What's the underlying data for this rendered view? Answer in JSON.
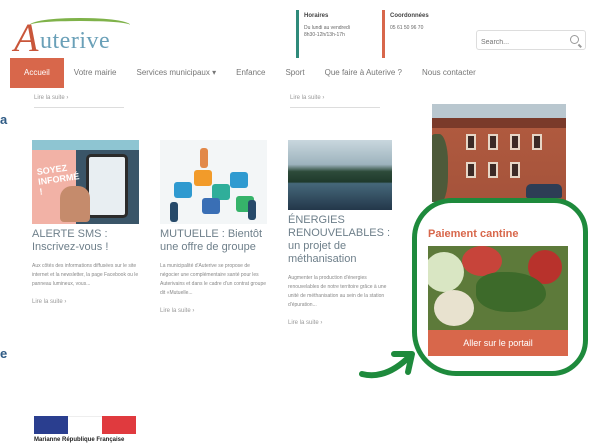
{
  "header": {
    "logo_text": "Auterive",
    "hours": {
      "title": "Horaires",
      "lines": [
        "Du lundi au vendredi",
        "8h30-12h/13h-17h"
      ],
      "color": "#2f8a7a"
    },
    "contact": {
      "title": "Coordonnées",
      "lines": [
        "05 61 50 96 70"
      ],
      "color": "#d8674b"
    },
    "search_placeholder": "Search..."
  },
  "nav": {
    "items": [
      "Accueil",
      "Votre mairie",
      "Services municipaux",
      "Enfance",
      "Sport",
      "Que faire à Auterive ?",
      "Nous contacter"
    ],
    "active_index": 0,
    "accent_color": "#d8674b"
  },
  "top_links": [
    "Lire la suite",
    "Lire la suite"
  ],
  "cards": [
    {
      "title": "ALERTE SMS : Inscrivez-vous !",
      "description": "Aux côtés des informations diffusées sur le site internet et la newsletter, la page Facebook ou le panneau lumineux, vous...",
      "link": "Lire la suite",
      "thumb_text": "SOYEZ INFORMÉ !"
    },
    {
      "title": "MUTUELLE : Bientôt une offre de groupe",
      "description": "La municipalité d'Auterive se propose de négocier une complémentaire santé pour les Auterivains et dans le cadre d'un contrat groupe dit «Mutuelle...",
      "link": "Lire la suite"
    },
    {
      "title": "ÉNERGIES RENOUVELABLES : un projet de méthanisation",
      "description": "Augmenter la production d'énergies renouvelables de notre territoire grâce à une unité de méthanisation au sein de la station d'épuration...",
      "link": "Lire la suite"
    }
  ],
  "cantine": {
    "title": "Paiement cantine",
    "button": "Aller sur le portail"
  },
  "edge_labels": [
    "a",
    "e"
  ],
  "annotation_color": "#1e8a3c",
  "footer": {
    "marianne_text": "Marianne République Française"
  }
}
